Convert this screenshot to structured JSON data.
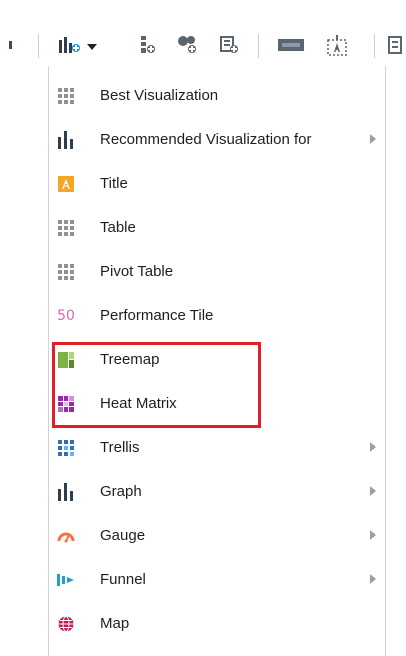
{
  "toolbar": {
    "buttons": [
      {
        "icon": "partial-toolbar-icon"
      },
      {
        "icon": "new-view-graph-dropdown-icon"
      },
      {
        "icon": "add-measure-icon"
      },
      {
        "icon": "add-group-icon"
      },
      {
        "icon": "add-calc-icon"
      },
      {
        "icon": "xyz-text-icon"
      },
      {
        "icon": "insert-text-box-icon"
      },
      {
        "icon": "partial-toolbar-icon-right"
      }
    ]
  },
  "menu": {
    "items": [
      {
        "label": "Best Visualization",
        "icon": "best-visualization-grid-icon",
        "submenu": false
      },
      {
        "label": "Recommended Visualization for",
        "icon": "bar-graph-icon",
        "submenu": true
      },
      {
        "label": "Title",
        "icon": "title-icon",
        "submenu": false
      },
      {
        "label": "Table",
        "icon": "table-grid-icon",
        "submenu": false
      },
      {
        "label": "Pivot Table",
        "icon": "pivot-table-grid-icon",
        "submenu": false
      },
      {
        "label": "Performance Tile",
        "icon": "performance-tile-icon",
        "icon_text": "50",
        "submenu": false
      },
      {
        "label": "Treemap",
        "icon": "treemap-icon",
        "submenu": false
      },
      {
        "label": "Heat Matrix",
        "icon": "heat-matrix-icon",
        "submenu": false
      },
      {
        "label": "Trellis",
        "icon": "trellis-grid-icon",
        "submenu": true
      },
      {
        "label": "Graph",
        "icon": "bar-graph-icon",
        "submenu": true
      },
      {
        "label": "Gauge",
        "icon": "gauge-icon",
        "submenu": true
      },
      {
        "label": "Funnel",
        "icon": "funnel-icon",
        "submenu": true
      },
      {
        "label": "Map",
        "icon": "globe-map-icon",
        "submenu": false
      }
    ]
  },
  "colors": {
    "highlight_border": "#e02026",
    "toolbar_icon": "#3a4a5a",
    "title_icon": "#f5a623",
    "performance_tile": "#d46ab5",
    "treemap": "#8bc34a",
    "heat_matrix": "#9c27b0",
    "trellis": "#2f6fb5",
    "gauge": "#ff7043",
    "funnel": "#1fa1c8",
    "map": "#c2185b"
  }
}
